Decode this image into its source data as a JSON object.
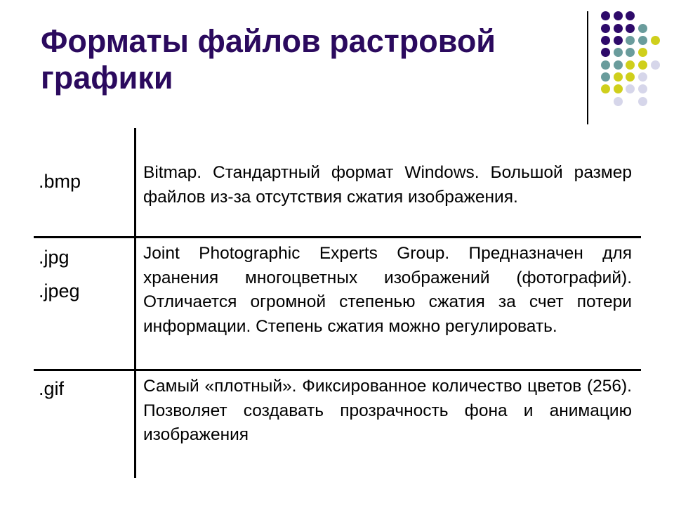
{
  "slide": {
    "title_lines": [
      "Форматы файлов растровой",
      "графики"
    ],
    "title_color": "#2b0a5e"
  },
  "decoration": {
    "icon": "dot-grid-icon",
    "colors": {
      "purple": "#2e0a6a",
      "teal": "#6a9c9c",
      "yellow": "#cfcf1c",
      "lavender": "#d6d6ea"
    },
    "grid": [
      [
        "purple",
        "purple",
        "purple",
        null,
        null
      ],
      [
        "purple",
        "purple",
        "purple",
        "teal",
        null
      ],
      [
        "purple",
        "purple",
        "teal",
        "teal",
        "yellow"
      ],
      [
        "purple",
        "teal",
        "teal",
        "yellow",
        null
      ],
      [
        "teal",
        "teal",
        "yellow",
        "yellow",
        "lavender"
      ],
      [
        "teal",
        "yellow",
        "yellow",
        "lavender",
        null
      ],
      [
        "yellow",
        "yellow",
        "lavender",
        "lavender",
        null
      ],
      [
        null,
        "lavender",
        null,
        "lavender",
        null
      ]
    ]
  },
  "table": {
    "rows": [
      {
        "formats": [
          ".bmp"
        ],
        "description": "Bitmap. Стандартный формат Windows. Большой размер файлов из-за отсутствия сжатия изображения."
      },
      {
        "formats": [
          ".jpg",
          ".jpeg"
        ],
        "description": "Joint Photographic Experts Group. Предназначен для хранения многоцветных изображений (фотографий). Отличается огромной степенью сжатия за счет потери информации. Степень сжатия можно регулировать."
      },
      {
        "formats": [
          ".gif"
        ],
        "description": "Самый «плотный». Фиксированное количество цветов (256). Позволяет создавать прозрачность фона и анимацию изображения"
      }
    ]
  }
}
